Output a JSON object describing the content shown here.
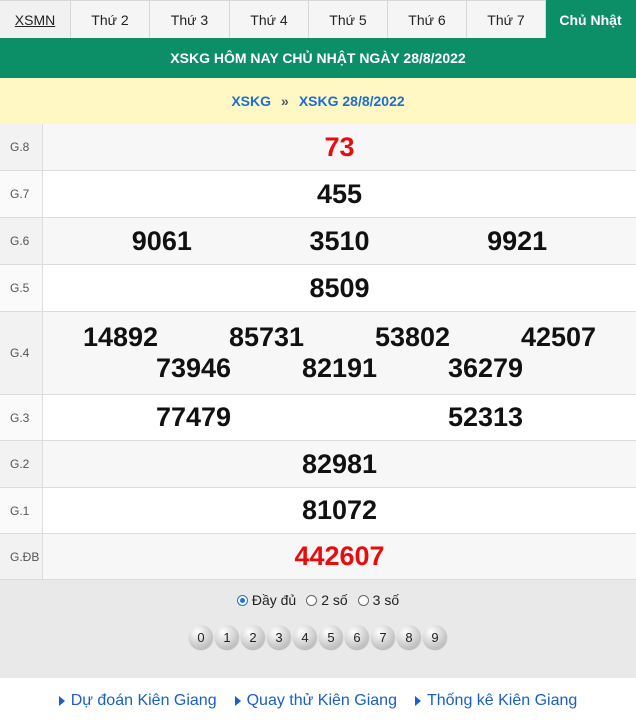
{
  "tabs": [
    {
      "label": "XSMN"
    },
    {
      "label": "Thứ 2"
    },
    {
      "label": "Thứ 3"
    },
    {
      "label": "Thứ 4"
    },
    {
      "label": "Thứ 5"
    },
    {
      "label": "Thứ 6"
    },
    {
      "label": "Thứ 7"
    },
    {
      "label": "Chủ Nhật"
    }
  ],
  "header": {
    "title": "XSKG HÔM NAY CHỦ NHẬT NGÀY 28/8/2022"
  },
  "breadcrumb": {
    "first": "XSKG",
    "separator": "»",
    "second": "XSKG 28/8/2022"
  },
  "prizes": {
    "g8": {
      "label": "G.8",
      "values": [
        "73"
      ]
    },
    "g7": {
      "label": "G.7",
      "values": [
        "455"
      ]
    },
    "g6": {
      "label": "G.6",
      "values": [
        "9061",
        "3510",
        "9921"
      ]
    },
    "g5": {
      "label": "G.5",
      "values": [
        "8509"
      ]
    },
    "g4": {
      "label": "G.4",
      "values": [
        "14892",
        "85731",
        "53802",
        "42507",
        "73946",
        "82191",
        "36279"
      ]
    },
    "g3": {
      "label": "G.3",
      "values": [
        "77479",
        "52313"
      ]
    },
    "g2": {
      "label": "G.2",
      "values": [
        "82981"
      ]
    },
    "g1": {
      "label": "G.1",
      "values": [
        "81072"
      ]
    },
    "gdb": {
      "label": "G.ĐB",
      "values": [
        "442607"
      ]
    }
  },
  "display_options": [
    {
      "label": "Đầy đủ",
      "selected": true
    },
    {
      "label": "2 số",
      "selected": false
    },
    {
      "label": "3 số",
      "selected": false
    }
  ],
  "digits": [
    "0",
    "1",
    "2",
    "3",
    "4",
    "5",
    "6",
    "7",
    "8",
    "9"
  ],
  "footer_links": [
    {
      "label": "Dự đoán Kiên Giang"
    },
    {
      "label": "Quay thử Kiên Giang"
    },
    {
      "label": "Thống kê Kiên Giang"
    }
  ],
  "colors": {
    "brand_green": "#0c8e67",
    "highlight_red": "#e80c0c",
    "breadcrumb_bg": "#fff8c4",
    "link_blue": "#1a5fc6"
  }
}
